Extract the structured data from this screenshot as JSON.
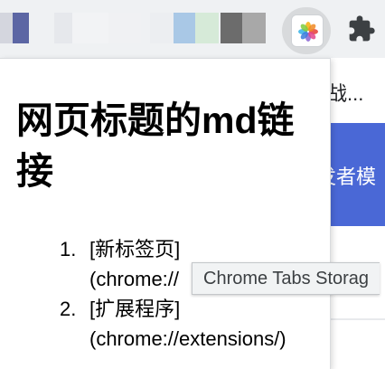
{
  "page": {
    "partial_text_1": "战...",
    "partial_text_2": "发者模"
  },
  "toolbar": {
    "extension_icon": "flower-photos-icon",
    "extensions_button_icon": "puzzle-icon"
  },
  "popup": {
    "title": "网页标题的md链接",
    "items": [
      {
        "number": "1.",
        "title": "[新标签页]",
        "url": "(chrome://"
      },
      {
        "number": "2.",
        "title": "[扩展程序]",
        "url": "(chrome://extensions/)"
      }
    ]
  },
  "tooltip": {
    "text": "Chrome Tabs Storag"
  }
}
